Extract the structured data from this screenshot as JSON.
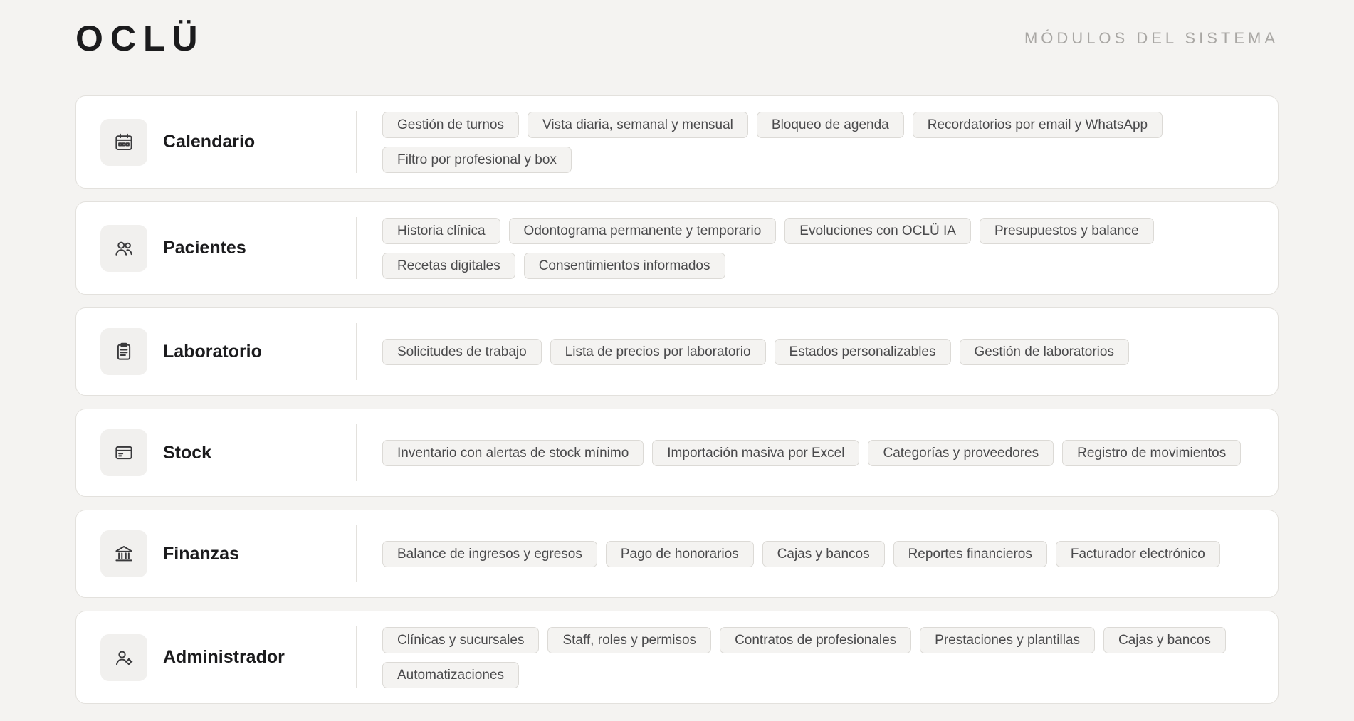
{
  "header": {
    "logo": "OCLÜ",
    "section_label": "MÓDULOS DEL SISTEMA"
  },
  "modules": [
    {
      "title": "Calendario",
      "icon": "calendar-icon",
      "tags": [
        "Gestión de turnos",
        "Vista diaria, semanal y mensual",
        "Bloqueo de agenda",
        "Recordatorios por email y WhatsApp",
        "Filtro por profesional y box"
      ]
    },
    {
      "title": "Pacientes",
      "icon": "users-icon",
      "tags": [
        "Historia clínica",
        "Odontograma permanente y temporario",
        "Evoluciones con OCLÜ IA",
        "Presupuestos y balance",
        "Recetas digitales",
        "Consentimientos informados"
      ]
    },
    {
      "title": "Laboratorio",
      "icon": "clipboard-icon",
      "tags": [
        "Solicitudes de trabajo",
        "Lista de precios por laboratorio",
        "Estados personalizables",
        "Gestión de laboratorios"
      ]
    },
    {
      "title": "Stock",
      "icon": "card-icon",
      "tags": [
        "Inventario con alertas de stock mínimo",
        "Importación masiva por Excel",
        "Categorías y proveedores",
        "Registro de movimientos"
      ]
    },
    {
      "title": "Finanzas",
      "icon": "bank-icon",
      "tags": [
        "Balance de ingresos y egresos",
        "Pago de honorarios",
        "Cajas y bancos",
        "Reportes financieros",
        "Facturador electrónico"
      ]
    },
    {
      "title": "Administrador",
      "icon": "user-settings-icon",
      "tags": [
        "Clínicas y sucursales",
        "Staff, roles y permisos",
        "Contratos de profesionales",
        "Prestaciones y plantillas",
        "Cajas y bancos",
        "Automatizaciones"
      ]
    }
  ]
}
